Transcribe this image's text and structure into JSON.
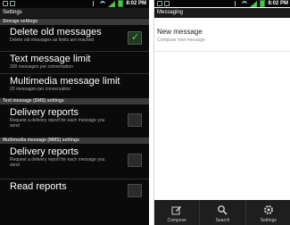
{
  "status_bar": {
    "time": "8:02 PM"
  },
  "settings": {
    "title": "Settings",
    "sections": [
      {
        "header": "Storage settings"
      },
      {
        "header": "Text message (SMS) settings"
      },
      {
        "header": "Multimedia message (MMS) settings"
      }
    ],
    "items": [
      {
        "title": "Delete old messages",
        "summary": "Delete old messages as limits are reached",
        "checkbox": true,
        "checked": true
      },
      {
        "title": "Text message limit",
        "summary": "200 messages per conversation"
      },
      {
        "title": "Multimedia message limit",
        "summary": "20 messages per conversation"
      },
      {
        "title": "Delivery reports",
        "summary": "Request a delivery report for each message you send",
        "checkbox": true,
        "checked": false
      },
      {
        "title": "Delivery reports",
        "summary": "Request a delivery report for each message you send",
        "checkbox": true,
        "checked": false
      },
      {
        "title": "Read reports",
        "checkbox": true,
        "checked": false
      }
    ]
  },
  "messaging": {
    "title": "Messaging",
    "new_message_title": "New message",
    "new_message_subtitle": "Compose new message",
    "bottom_bar": [
      {
        "label": "Compose",
        "icon": "compose-icon"
      },
      {
        "label": "Search",
        "icon": "search-icon"
      },
      {
        "label": "Settings",
        "icon": "settings-icon"
      }
    ]
  },
  "colors": {
    "checkbox_tick": "#62d13a",
    "signal": "#4fc24f"
  }
}
